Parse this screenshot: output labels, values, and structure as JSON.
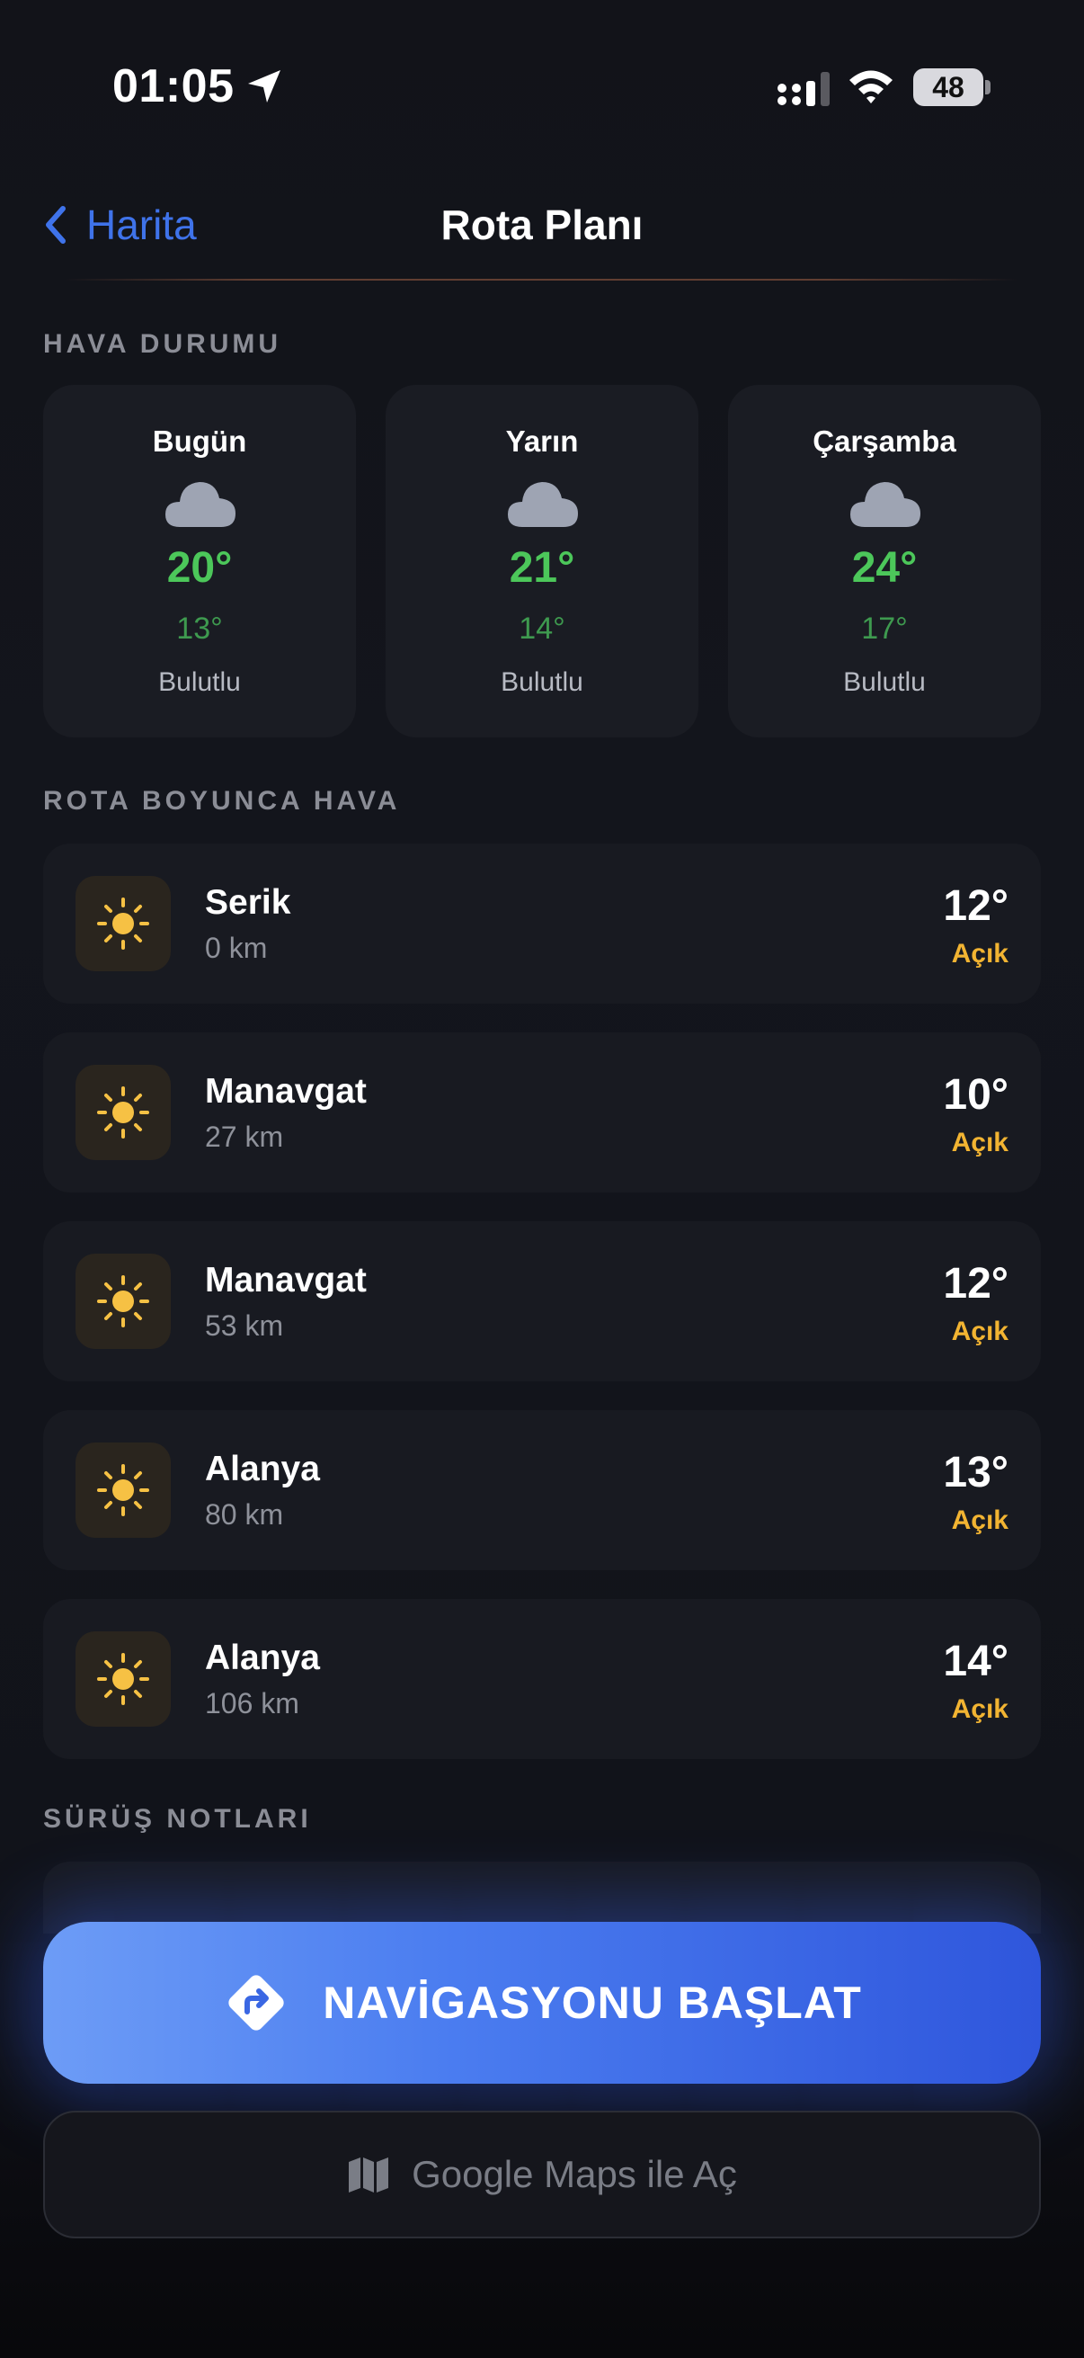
{
  "status_bar": {
    "time": "01:05",
    "battery": "48"
  },
  "nav": {
    "back_label": "Harita",
    "title": "Rota Planı"
  },
  "weather": {
    "section_title": "HAVA DURUMU",
    "days": [
      {
        "day": "Bugün",
        "high": "20°",
        "low": "13°",
        "condition": "Bulutlu",
        "icon": "cloud-icon"
      },
      {
        "day": "Yarın",
        "high": "21°",
        "low": "14°",
        "condition": "Bulutlu",
        "icon": "cloud-icon"
      },
      {
        "day": "Çarşamba",
        "high": "24°",
        "low": "17°",
        "condition": "Bulutlu",
        "icon": "cloud-icon"
      }
    ]
  },
  "route_weather": {
    "section_title": "ROTA BOYUNCA HAVA",
    "items": [
      {
        "city": "Serik",
        "km": "0 km",
        "temp": "12°",
        "condition": "Açık",
        "icon": "sun-icon"
      },
      {
        "city": "Manavgat",
        "km": "27 km",
        "temp": "10°",
        "condition": "Açık",
        "icon": "sun-icon"
      },
      {
        "city": "Manavgat",
        "km": "53 km",
        "temp": "12°",
        "condition": "Açık",
        "icon": "sun-icon"
      },
      {
        "city": "Alanya",
        "km": "80 km",
        "temp": "13°",
        "condition": "Açık",
        "icon": "sun-icon"
      },
      {
        "city": "Alanya",
        "km": "106 km",
        "temp": "14°",
        "condition": "Açık",
        "icon": "sun-icon"
      }
    ]
  },
  "driving_notes": {
    "section_title": "SÜRÜŞ NOTLARI"
  },
  "actions": {
    "start_navigation": "NAVİGASYONU BAŞLAT",
    "open_google_maps": "Google Maps ile Aç"
  },
  "colors": {
    "accent_blue": "#3f73ea",
    "temp_green": "#4cc75a",
    "clear_yellow": "#f2b432",
    "background": "#121319"
  }
}
